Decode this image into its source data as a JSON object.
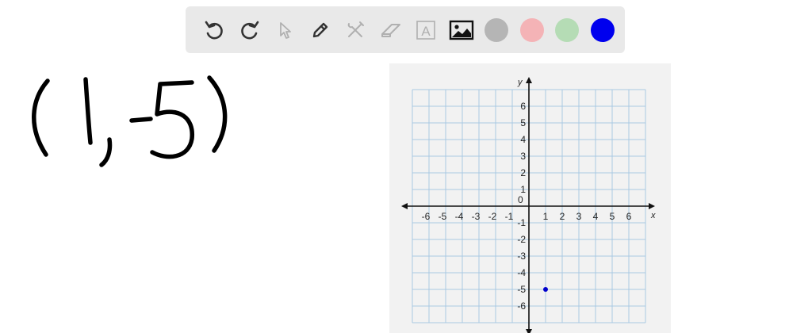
{
  "toolbar": {
    "tools": [
      {
        "name": "undo-icon",
        "enabled": true
      },
      {
        "name": "redo-icon",
        "enabled": true
      },
      {
        "name": "select-pointer-icon",
        "enabled": false
      },
      {
        "name": "pen-icon",
        "enabled": true
      },
      {
        "name": "tools-icon",
        "enabled": false
      },
      {
        "name": "eraser-icon",
        "enabled": false
      },
      {
        "name": "text-icon",
        "enabled": false,
        "label": "A"
      },
      {
        "name": "image-icon",
        "enabled": true
      }
    ],
    "colors": [
      "#b5b5b5",
      "#f4b3b6",
      "#b5dcb5",
      "#0000ee"
    ],
    "selected_color": "#0000ee"
  },
  "canvas": {
    "handwritten_text": "(1,-5)"
  },
  "graph": {
    "x_axis_label": "x",
    "y_axis_label": "y",
    "origin_label": "0",
    "x_ticks": [
      "-6",
      "-5",
      "-4",
      "-3",
      "-2",
      "-1",
      "1",
      "2",
      "3",
      "4",
      "5",
      "6"
    ],
    "y_ticks": [
      "6",
      "5",
      "4",
      "3",
      "2",
      "1",
      "-1",
      "-2",
      "-3",
      "-4",
      "-5",
      "-6"
    ],
    "x_range": [
      -7,
      7
    ],
    "y_range": [
      -7,
      7
    ],
    "grid": true,
    "grid_color": "#a9c9e3",
    "point": {
      "x": 1,
      "y": -5,
      "color": "#0000cc"
    }
  }
}
